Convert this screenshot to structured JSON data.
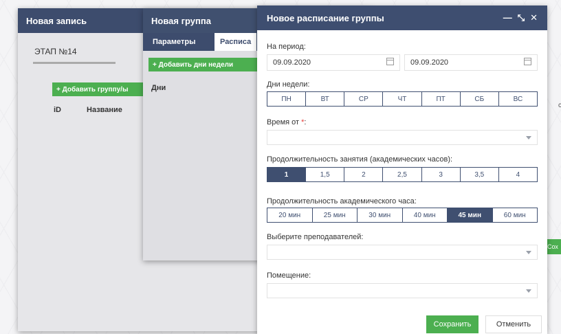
{
  "window1": {
    "title": "Новая запись",
    "tab": "ЭТАП №14",
    "add_button": "+ Добавить группу/ы",
    "columns": [
      "iD",
      "Название"
    ]
  },
  "window2": {
    "title": "Новая группа",
    "tabs": [
      "Параметры",
      "Расписа"
    ],
    "add_button": "+ Добавить дни недели",
    "days_label": "Дни"
  },
  "dialog": {
    "title": "Новое расписание группы",
    "period_label": "На период:",
    "date_from": "09.09.2020",
    "date_to": "09.09.2020",
    "weekdays_label": "Дни недели:",
    "weekdays": [
      "ПН",
      "ВТ",
      "СР",
      "ЧТ",
      "ПТ",
      "СБ",
      "ВС"
    ],
    "time_label": "Время от",
    "time_required": "*",
    "time_suffix": ":",
    "duration_label": "Продолжительность занятия (академических часов):",
    "durations": [
      "1",
      "1,5",
      "2",
      "2,5",
      "3",
      "3,5",
      "4"
    ],
    "duration_selected": "1",
    "hour_label": "Продолжительность академического часа:",
    "hours": [
      "20 мин",
      "25 мин",
      "30 мин",
      "40 мин",
      "45 мин",
      "60 мин"
    ],
    "hour_selected": "45 мин",
    "teachers_label": "Выберите преподавателей:",
    "room_label": "Помещение:",
    "save_label": "Сохранить",
    "cancel_label": "Отменить"
  },
  "edge": {
    "save_fragment": "Сох",
    "col_fragment": "с"
  },
  "colors": {
    "titlebar": "#3e4e70",
    "accent": "#4caf50",
    "required": "#e53935"
  }
}
